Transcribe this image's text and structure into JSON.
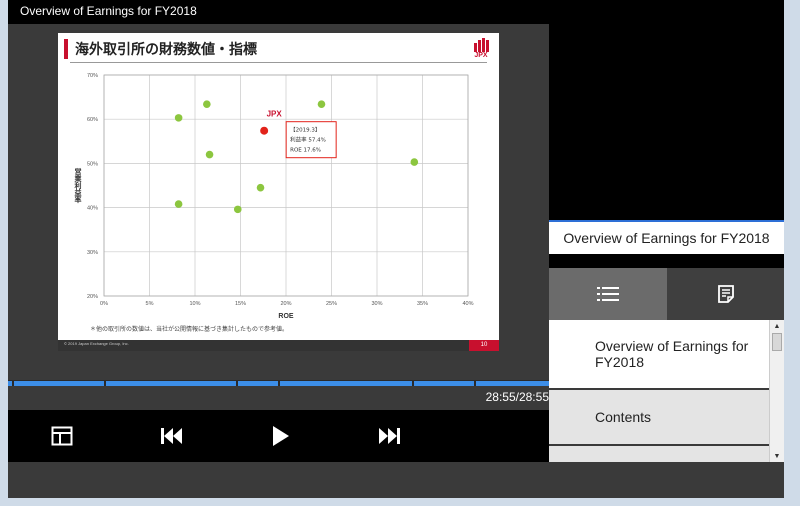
{
  "window": {
    "title": "Overview of Earnings for FY2018"
  },
  "slide": {
    "title": "海外取引所の財務数値・指標",
    "logo_text": "JPX",
    "footnote": "＊他の取引所の数値は、当社が公開情報に基づき集計したもので参考値。",
    "copyright": "© 2019 Japan Exchange Group, Inc.",
    "page_number": "10"
  },
  "chart_data": {
    "type": "scatter",
    "title": "",
    "xlabel": "ROE",
    "ylabel": "営業利益率",
    "xlim": [
      0,
      40
    ],
    "ylim": [
      20,
      70
    ],
    "x_ticks": [
      "0%",
      "5%",
      "10%",
      "15%",
      "20%",
      "25%",
      "30%",
      "35%",
      "40%"
    ],
    "y_ticks": [
      "20%",
      "30%",
      "40%",
      "50%",
      "60%",
      "70%"
    ],
    "series": [
      {
        "name": "",
        "color": "#8cc63f",
        "points": [
          {
            "x": 8.2,
            "y": 60.3
          },
          {
            "x": 11.3,
            "y": 63.4
          },
          {
            "x": 11.6,
            "y": 52.0
          },
          {
            "x": 8.2,
            "y": 40.8
          },
          {
            "x": 14.7,
            "y": 39.6
          },
          {
            "x": 17.2,
            "y": 44.5
          },
          {
            "x": 23.9,
            "y": 63.4
          },
          {
            "x": 34.1,
            "y": 50.3
          }
        ]
      },
      {
        "name": "JPX",
        "color": "#e2231a",
        "points": [
          {
            "x": 17.6,
            "y": 57.4
          }
        ]
      }
    ],
    "annotation": {
      "label": "JPX",
      "lines": [
        "【2019.3】",
        "利益率 57.4%",
        "ROE 17.6%"
      ]
    }
  },
  "player": {
    "time": "28:55/28:55",
    "progress": 1.0
  },
  "sidebar": {
    "video_title": "Overview of Earnings for FY2018",
    "tabs": [
      {
        "label": "list-icon"
      },
      {
        "label": "notes-icon"
      }
    ],
    "items": [
      {
        "label": "Overview of Earnings for FY2018"
      },
      {
        "label": "Contents"
      },
      {
        "label": ""
      }
    ]
  },
  "colors": {
    "accent": "#3c8ee8",
    "brand": "#c8102e",
    "point": "#8cc63f"
  }
}
